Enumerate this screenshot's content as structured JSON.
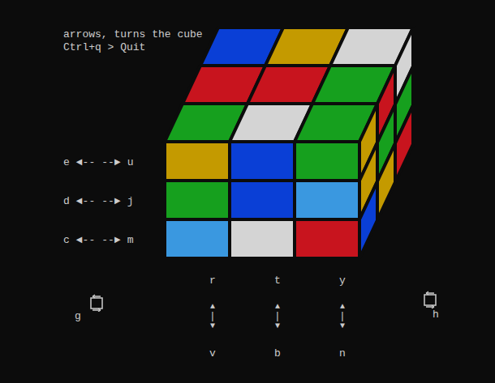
{
  "help": [
    "arrows, turns the cube",
    "Ctrl+q > Quit"
  ],
  "cube": {
    "top": [
      [
        "#0a3fd6",
        "#c49a00",
        "#d4d4d4"
      ],
      [
        "#c8141e",
        "#c8141e",
        "#16a01e"
      ],
      [
        "#16a01e",
        "#d4d4d4",
        "#16a01e"
      ]
    ],
    "front": [
      [
        "#c49a00",
        "#0a3fd6",
        "#16a01e"
      ],
      [
        "#16a01e",
        "#0a3fd6",
        "#3a98e0"
      ],
      [
        "#3a98e0",
        "#d4d4d4",
        "#c8141e"
      ]
    ],
    "right": [
      [
        "#c49a00",
        "#c8141e",
        "#d4d4d4"
      ],
      [
        "#c49a00",
        "#16a01e",
        "#16a01e"
      ],
      [
        "#0a3fd6",
        "#c49a00",
        "#c8141e"
      ]
    ]
  },
  "row_keys": {
    "arrow_left": "◄--",
    "arrow_right": "--►",
    "rows": [
      {
        "left": "e",
        "right": "u"
      },
      {
        "left": "d",
        "right": "j"
      },
      {
        "left": "c",
        "right": "m"
      }
    ]
  },
  "column_keys": {
    "arrow_up": "▲",
    "bar": "|",
    "arrow_down": "▼",
    "columns": [
      {
        "top": "r",
        "bottom": "v"
      },
      {
        "top": "t",
        "bottom": "b"
      },
      {
        "top": "y",
        "bottom": "n"
      }
    ]
  },
  "rotate_keys": {
    "left": "g",
    "right": "h"
  }
}
